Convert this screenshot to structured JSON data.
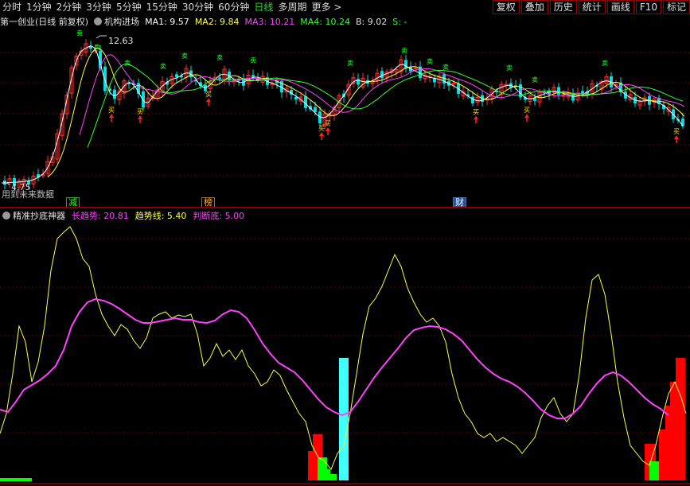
{
  "toolbar": {
    "periods": [
      {
        "label": "分时"
      },
      {
        "label": "1分钟"
      },
      {
        "label": "2分钟"
      },
      {
        "label": "3分钟"
      },
      {
        "label": "5分钟"
      },
      {
        "label": "15分钟"
      },
      {
        "label": "30分钟"
      },
      {
        "label": "60分钟"
      },
      {
        "label": "日线"
      },
      {
        "label": "多周期"
      },
      {
        "label": "更多 >"
      }
    ],
    "active_period": "日线",
    "right_buttons": [
      {
        "label": "复权"
      },
      {
        "label": "叠加"
      },
      {
        "label": "历史"
      },
      {
        "label": "统计"
      },
      {
        "label": "画线"
      },
      {
        "label": "F10"
      },
      {
        "label": "标记"
      }
    ]
  },
  "main_chart": {
    "stock_name": "第一创业(日线 前复权)",
    "indicator_name": "机构进场",
    "ma1": "MA1: 9.57",
    "ma2": "MA2: 9.84",
    "ma3": "MA3: 10.21",
    "ma4": "MA4: 10.24",
    "b_value": "B: 9.02",
    "s_value": "S: -",
    "high_label": "12.63",
    "low_label": "4.75",
    "future_data_note": "用到未来数据",
    "event_tags": [
      {
        "label": "减"
      },
      {
        "label": "榜"
      },
      {
        "label": "财"
      }
    ],
    "colors": {
      "up": "#ff3030",
      "down": "#00e0e0",
      "ma1": "#ffffff",
      "ma2": "#ffff40",
      "ma3": "#ff40ff",
      "ma4": "#30ff30",
      "grid": "#6a0000"
    }
  },
  "indicator": {
    "name": "精准抄底神器",
    "long_trend": "长趋势: 20.81",
    "trend_line": "趋势线: 5.40",
    "judge_bottom": "判断底: 5.00",
    "colors": {
      "long_trend": "#ff40ff",
      "trend_line": "#ffff40",
      "judge_bottom": "#ff40ff",
      "bar_red": "#ff0000",
      "bar_green": "#00ff00",
      "bar_cyan": "#40ffff"
    }
  },
  "chart_data": {
    "type": "candlestick",
    "series": [
      {
        "name": "MA1",
        "values": []
      },
      {
        "name": "MA2",
        "values": []
      },
      {
        "name": "MA3",
        "values": []
      },
      {
        "name": "MA4",
        "values": []
      }
    ],
    "price_high": 12.63,
    "price_low": 4.75
  }
}
